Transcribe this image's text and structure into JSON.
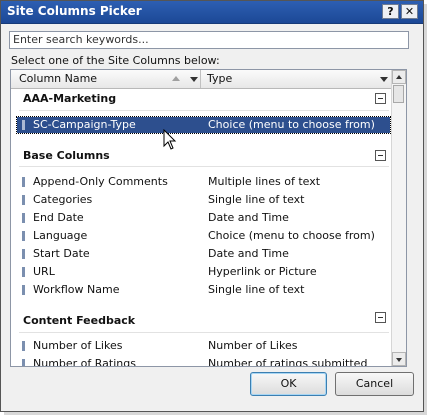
{
  "window": {
    "title": "Site Columns Picker",
    "help_label": "?",
    "close_label": "✕"
  },
  "search": {
    "placeholder": "Enter search keywords..."
  },
  "instruction": "Select one of the Site Columns below:",
  "columns": {
    "name": "Column Name",
    "type": "Type"
  },
  "groups": [
    {
      "name": "AAA-Marketing",
      "rows": [
        {
          "name": "SC-Campaign-Type",
          "type": "Choice (menu to choose from)",
          "selected": true
        }
      ]
    },
    {
      "name": "Base Columns",
      "rows": [
        {
          "name": "Append-Only Comments",
          "type": "Multiple lines of text"
        },
        {
          "name": "Categories",
          "type": "Single line of text"
        },
        {
          "name": "End Date",
          "type": "Date and Time"
        },
        {
          "name": "Language",
          "type": "Choice (menu to choose from)"
        },
        {
          "name": "Start Date",
          "type": "Date and Time"
        },
        {
          "name": "URL",
          "type": "Hyperlink or Picture"
        },
        {
          "name": "Workflow Name",
          "type": "Single line of text"
        }
      ]
    },
    {
      "name": "Content Feedback",
      "rows": [
        {
          "name": "Number of Likes",
          "type": "Number of Likes"
        },
        {
          "name": "Number of Ratings",
          "type": "Number of ratings submitted"
        }
      ]
    }
  ],
  "buttons": {
    "ok": "OK",
    "cancel": "Cancel"
  }
}
